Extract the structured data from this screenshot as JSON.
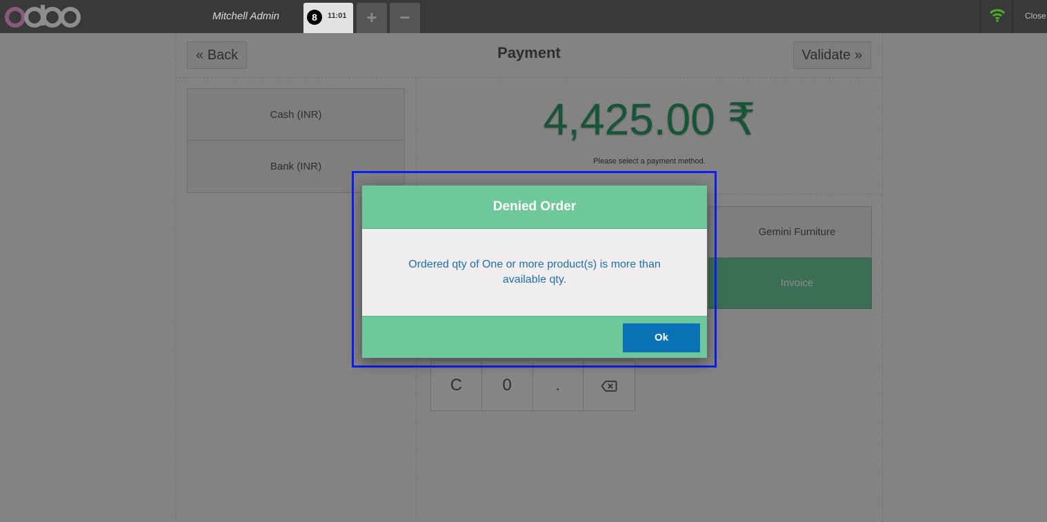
{
  "topbar": {
    "logo_text": "odoo",
    "cashier_name": "Mitchell Admin",
    "order_tab": {
      "sequence": "8",
      "time": "11:01"
    },
    "add_order_label": "+",
    "remove_order_label": "−",
    "close_label": "Close"
  },
  "header": {
    "back_label": "Back",
    "title": "Payment",
    "validate_label": "Validate"
  },
  "payment_methods": [
    "Cash (INR)",
    "Bank (INR)"
  ],
  "amount_due": "4,425.00 ₹",
  "payment_hint": "Please select a payment method.",
  "customer_label": "Gemini Furniture",
  "invoice_label": "Invoice",
  "numpad": {
    "keys": [
      "C",
      "0",
      "."
    ],
    "backspace_icon": "backspace-icon"
  },
  "dialog": {
    "title": "Denied Order",
    "message": "Ordered qty of One or more product(s) is more than available qty.",
    "ok_label": "Ok"
  },
  "colors": {
    "topbar": "#393939",
    "accent_green": "#6ec89b",
    "amount_green": "#2d9a6a",
    "ok_blue": "#0a72b4",
    "message_blue": "#1f6fb0",
    "highlight": "#0a1dfa",
    "logo_purple": "#875a7b"
  }
}
